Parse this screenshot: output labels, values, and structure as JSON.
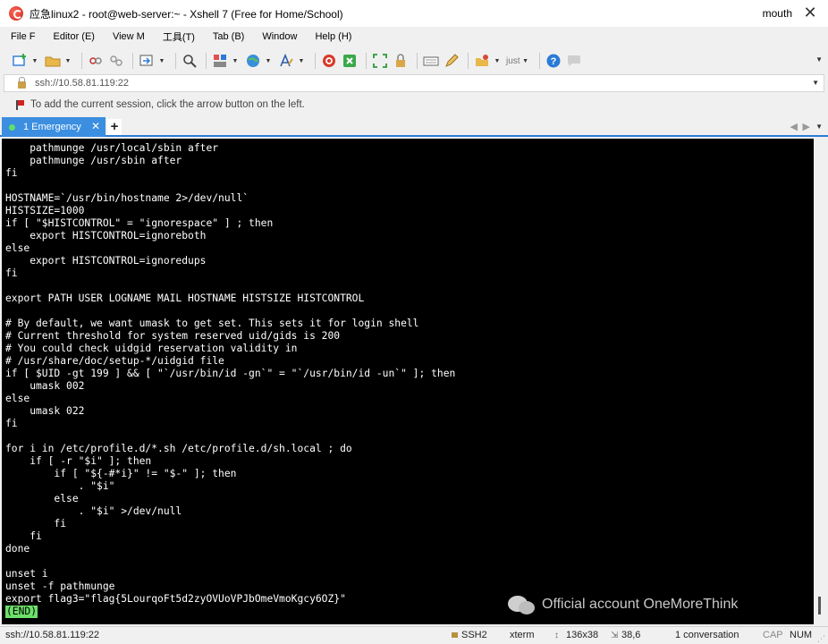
{
  "window": {
    "title": "应急linux2 - root@web-server:~ - Xshell 7 (Free for Home/School)",
    "user": "mouth",
    "close_glyph": "✕"
  },
  "menu": {
    "items": [
      "File F",
      "Editor (E)",
      "View M",
      "工具(T)",
      "Tab (B)",
      "Window",
      "Help (H)"
    ]
  },
  "toolbar": {
    "zoom_text": "just",
    "icons": [
      "new-session-icon",
      "open-folder-icon",
      "connect-icon",
      "disconnect-icon",
      "transfer-icon",
      "find-icon",
      "layout-icon",
      "globe-icon",
      "font-icon",
      "xshell-icon",
      "xftp-icon",
      "fullscreen-icon",
      "lock-icon",
      "keyboard-icon",
      "compose-icon",
      "script-icon",
      "help-icon",
      "chat-icon"
    ]
  },
  "address": {
    "value": "ssh://10.58.81.119:22"
  },
  "hint": {
    "text": "To add the current session, click the arrow button on the left."
  },
  "tabs": {
    "active_label": "1 Emergency",
    "close_glyph": "✕",
    "add_glyph": "+",
    "prev_glyph": "◀",
    "next_glyph": "▶",
    "status_color": "#5fe06a"
  },
  "terminal": {
    "lines": [
      "    pathmunge /usr/local/sbin after",
      "    pathmunge /usr/sbin after",
      "fi",
      "",
      "HOSTNAME=`/usr/bin/hostname 2>/dev/null`",
      "HISTSIZE=1000",
      "if [ \"$HISTCONTROL\" = \"ignorespace\" ] ; then",
      "    export HISTCONTROL=ignoreboth",
      "else",
      "    export HISTCONTROL=ignoredups",
      "fi",
      "",
      "export PATH USER LOGNAME MAIL HOSTNAME HISTSIZE HISTCONTROL",
      "",
      "# By default, we want umask to get set. This sets it for login shell",
      "# Current threshold for system reserved uid/gids is 200",
      "# You could check uidgid reservation validity in",
      "# /usr/share/doc/setup-*/uidgid file",
      "if [ $UID -gt 199 ] && [ \"`/usr/bin/id -gn`\" = \"`/usr/bin/id -un`\" ]; then",
      "    umask 002",
      "else",
      "    umask 022",
      "fi",
      "",
      "for i in /etc/profile.d/*.sh /etc/profile.d/sh.local ; do",
      "    if [ -r \"$i\" ]; then",
      "        if [ \"${-#*i}\" != \"$-\" ]; then",
      "            . \"$i\"",
      "        else",
      "            . \"$i\" >/dev/null",
      "        fi",
      "    fi",
      "done",
      "",
      "unset i",
      "unset -f pathmunge",
      "export flag3=\"flag{5LourqoFt5d2zyOVUoVPJbOmeVmoKgcy6OZ}\""
    ],
    "end_marker": "(END)",
    "background": "#000000",
    "foreground": "#ffffff",
    "marker_color": "#6ce06a"
  },
  "watermark": {
    "text": "Official account OneMoreThink"
  },
  "status": {
    "address": "ssh://10.58.81.119:22",
    "protocol": "SSH2",
    "terminal_type": "xterm",
    "size": "136x38",
    "cursor": "38,6",
    "sessions": "1 conversation",
    "caps": "CAP",
    "num": "NUM"
  }
}
